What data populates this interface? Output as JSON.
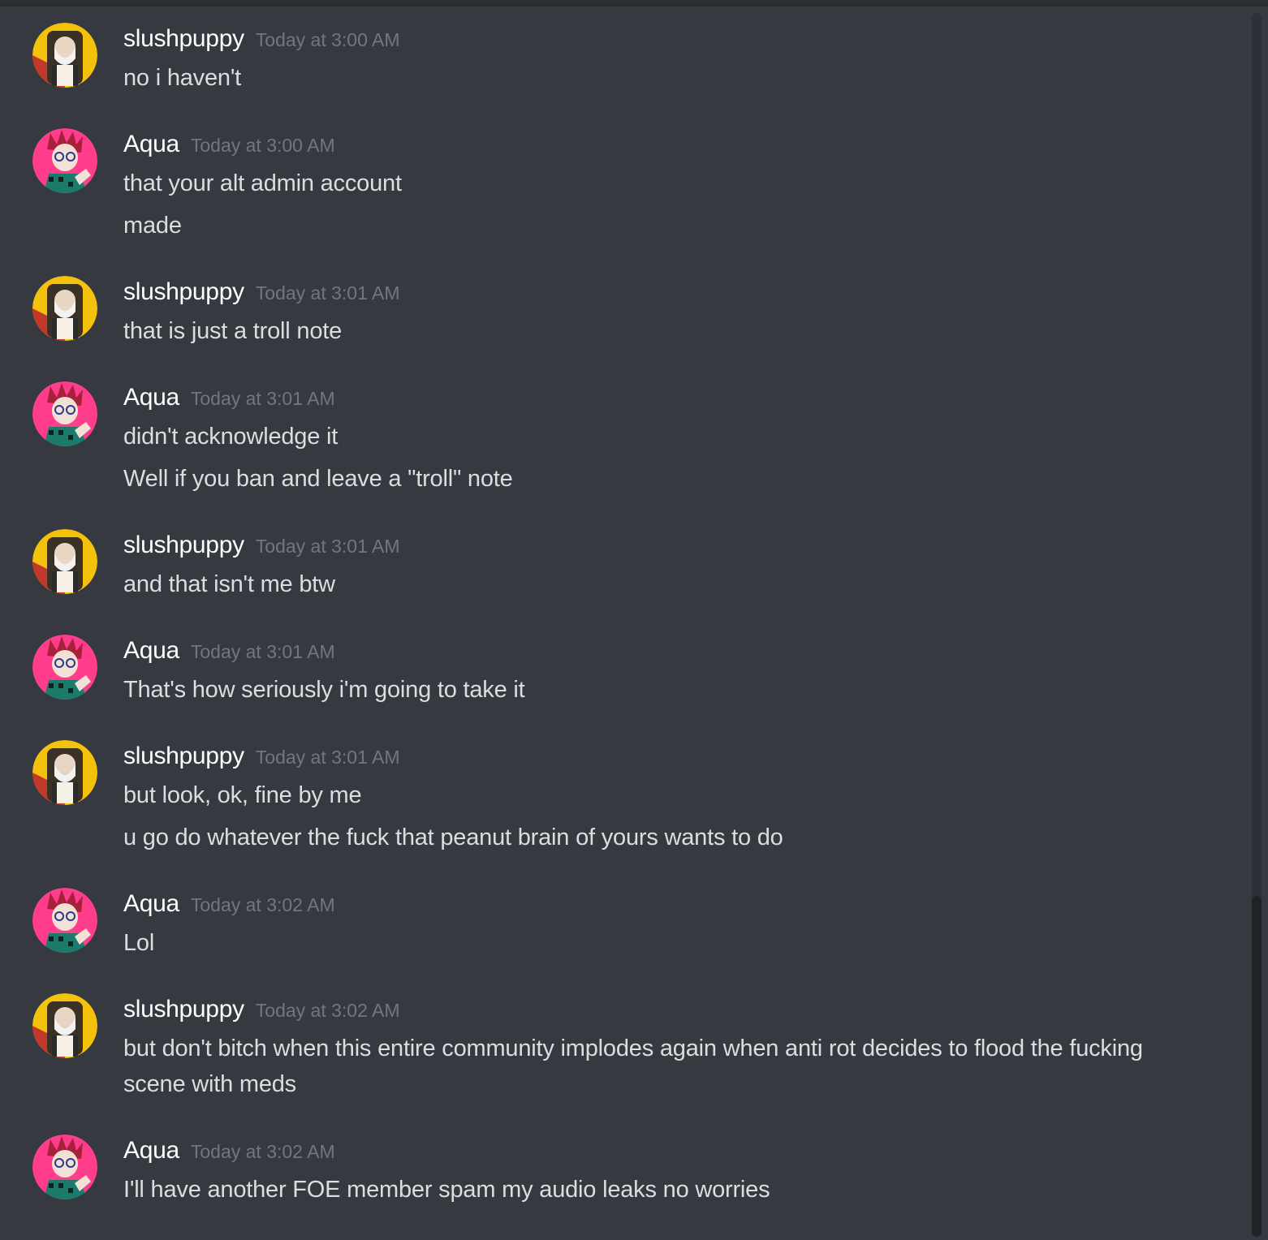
{
  "messages": [
    {
      "author": "slushpuppy",
      "avatar": "slushpuppy",
      "timestamp": "Today at 3:00 AM",
      "lines": [
        "no i haven't"
      ]
    },
    {
      "author": "Aqua",
      "avatar": "aqua",
      "timestamp": "Today at 3:00 AM",
      "lines": [
        "that your alt admin account",
        "made"
      ]
    },
    {
      "author": "slushpuppy",
      "avatar": "slushpuppy",
      "timestamp": "Today at 3:01 AM",
      "lines": [
        "that is just a troll note"
      ]
    },
    {
      "author": "Aqua",
      "avatar": "aqua",
      "timestamp": "Today at 3:01 AM",
      "lines": [
        "didn't acknowledge it",
        "Well if you ban and leave a \"troll\" note"
      ]
    },
    {
      "author": "slushpuppy",
      "avatar": "slushpuppy",
      "timestamp": "Today at 3:01 AM",
      "lines": [
        "and that isn't me btw"
      ]
    },
    {
      "author": "Aqua",
      "avatar": "aqua",
      "timestamp": "Today at 3:01 AM",
      "lines": [
        "That's how seriously i'm going to take it"
      ]
    },
    {
      "author": "slushpuppy",
      "avatar": "slushpuppy",
      "timestamp": "Today at 3:01 AM",
      "lines": [
        "but look, ok, fine by me",
        "u go do whatever the fuck that peanut brain of yours wants to do"
      ]
    },
    {
      "author": "Aqua",
      "avatar": "aqua",
      "timestamp": "Today at 3:02 AM",
      "lines": [
        "Lol"
      ]
    },
    {
      "author": "slushpuppy",
      "avatar": "slushpuppy",
      "timestamp": "Today at 3:02 AM",
      "lines": [
        "but don't bitch when this entire community implodes again when anti rot decides to flood the fucking scene with meds"
      ]
    },
    {
      "author": "Aqua",
      "avatar": "aqua",
      "timestamp": "Today at 3:02 AM",
      "lines": [
        "I'll have another FOE member spam my audio leaks no worries"
      ]
    }
  ],
  "colors": {
    "background": "#36393f",
    "username": "#ffffff",
    "timestamp": "#72767d",
    "message_text": "#dcddde"
  }
}
